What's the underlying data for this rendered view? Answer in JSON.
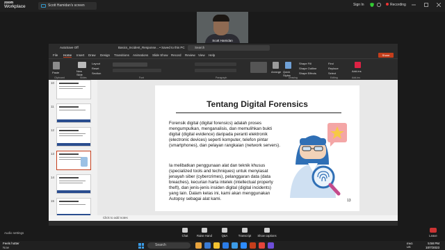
{
  "zoom": {
    "brand_line1": "zoom",
    "brand_line2": "Workplace",
    "share_tab": "Scott Hamidan's screen",
    "sign_in": "Sign In",
    "recording": "Recording",
    "participant_name": "Scott Hamidan",
    "audio_settings": "Audio settings",
    "controls": [
      "Chat",
      "Raise Hand",
      "Q&A",
      "Transcript",
      "Show captions"
    ],
    "leave": "Leave"
  },
  "ppt": {
    "autosave": "AutoSave",
    "autosave_state": "Off",
    "file_name": "Basics_Incident_Response... • Saved to this PC",
    "search_placeholder": "Search",
    "tabs": [
      "File",
      "Home",
      "Insert",
      "Draw",
      "Design",
      "Transitions",
      "Animations",
      "Slide Show",
      "Record",
      "Review",
      "View",
      "Help"
    ],
    "active_tab": "Home",
    "share_label": "Share",
    "ribbon": {
      "paste": "Paste",
      "new_slide": "New Slide",
      "layout": "Layout",
      "reset": "Reset",
      "section": "Section",
      "arrange": "Arrange",
      "quick_styles": "Quick Styles",
      "shape_fill": "Shape Fill",
      "shape_outline": "Shape Outline",
      "shape_effects": "Shape Effects",
      "find": "Find",
      "replace": "Replace",
      "select": "Select",
      "add_ins": "Add-ins",
      "groups": [
        "Clipboard",
        "Slides",
        "Font",
        "Paragraph",
        "Drawing",
        "Editing",
        "Add-ins"
      ]
    },
    "thumb_numbers": [
      "10",
      "11",
      "12",
      "13",
      "14",
      "15"
    ],
    "notes_placeholder": "Click to add notes",
    "slide": {
      "title": "Tentang Digital Forensics",
      "para1": "Forensik digital (digital forensics) adalah proses mengumpulkan, menganalisis, dan memulihkan bukti digital (digital evidence) daripada peranti elektronik (electronic devices) seperti komputer, telefon pintar (smartphones), dan pelayan rangkaian (network servers).",
      "para2": "Ia melibatkan penggunaan alat dan teknik khusus (specialized tools and techniques) untuk menyiasat jenayah siber (cybercrimes), pelanggaran data (data breaches), kecurian harta intelek (intellectual property theft), dan jenis-jenis insiden digital (digital incidents) yang lain. Dalam kelas ini, kami akan menggunakan Autopsy sebagai alat kami.",
      "number": "13"
    }
  },
  "taskbar": {
    "weather_temp": "Feels hotter",
    "weather_sub": "Now",
    "search": "Search",
    "lang1": "ENG",
    "lang2": "US",
    "time": "5:58 PM",
    "date": "10/7/2023"
  },
  "colors": {
    "ppt_accent": "#c43e1c",
    "zoom_bg": "#1a1a1a",
    "leave_red": "#cc3333"
  }
}
